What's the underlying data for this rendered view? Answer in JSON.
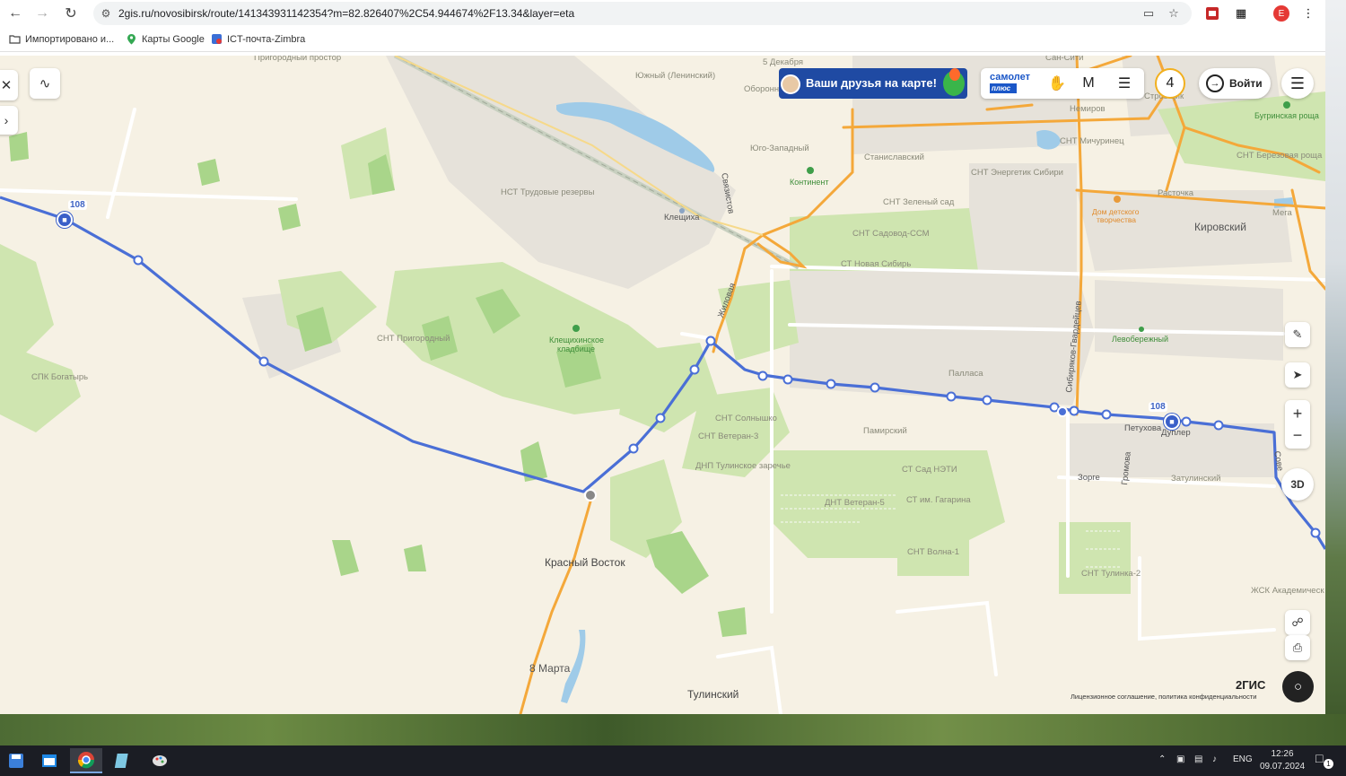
{
  "browser": {
    "url": "2gis.ru/novosibirsk/route/141343931142354?m=82.826407%2C54.944674%2F13.34&layer=eta",
    "profile_initial": "E",
    "bookmarks": [
      {
        "label": "Импортировано и...",
        "icon": "folder-icon"
      },
      {
        "label": "Карты Google",
        "icon": "google-maps-icon"
      },
      {
        "label": "ICT-почта-Zimbra",
        "icon": "zimbra-icon"
      }
    ]
  },
  "map": {
    "route_number": "108",
    "labels": {
      "prigorodny_prostor": "Пригородный простор",
      "dekabrya": "5 Декабря",
      "yuzhny": "Южный (Ленинский)",
      "oboron": "Оборонн",
      "yugo_zapadny": "Юго-Западный",
      "kontinent": "Континент",
      "stanislavsky": "Станиславский",
      "snt_energetik": "СНТ Энергетик Сибири",
      "snt_michurinets": "СНТ Мичуринец",
      "snt_berezovaya": "СНТ Березовая роща",
      "bugrinskaya": "Бугринская роща",
      "raschotka": "Расточка",
      "dom_tvorchestva_1": "Дом детского",
      "dom_tvorchestva_2": "творчества",
      "mega": "Мега",
      "kirovsky": "Кировский",
      "nst_trudovye": "НСТ Трудовые резервы",
      "kleshchikha": "Клещиха",
      "svyazistov": "Связистов",
      "snt_zeleny_sad": "СНТ Зеленый сад",
      "snt_sadovod": "СНТ Садовод-ССМ",
      "st_novaya_sibir": "СТ Новая Сибирь",
      "zhilovaya": "Жиловая",
      "snt_prigorodny": "СНТ Пригородный",
      "kladbishche_1": "Клещихинское",
      "kladbishche_2": "кладбище",
      "spk_bogatyr": "СПК Богатырь",
      "pallasa": "Палласа",
      "sibiryakov": "Сибиряков-Гвардейцев",
      "levoberezhny": "Левобережный",
      "snt_solnyshko": "СНТ Солнышко",
      "snt_veteran3": "СНТ Ветеран-3",
      "dnp_tulinskoe": "ДНП Тулинское заречье",
      "pamirsky": "Памирский",
      "st_sad_neti": "СТ Сад НЭТИ",
      "st_gagarina": "СТ им. Гагарина",
      "dnt_veteran5": "ДНТ Ветеран-5",
      "zorge": "Зорге",
      "gromova": "Громова",
      "zatulinsky": "Затулинский",
      "petukhova": "Петухова",
      "dupler": "Дуплер",
      "krasny_vostok": "Красный Восток",
      "snt_volna": "СНТ Волна-1",
      "snt_tulinka": "СНТ Тулинка-2",
      "zhsk": "ЖСК Академическ",
      "marta": "8 Марта",
      "tulinsky": "Тулинский",
      "nemirov": "Немиров",
      "stroviki": "Стровщик",
      "kan_siti": "Сан-Сити",
      "sov": "Сове"
    },
    "promo_text": "Ваши друзья на карте!",
    "samolet": "самолет",
    "samolet_sub": "плюс",
    "friends_count": "4",
    "login_label": "Войти",
    "btn_3d": "3D",
    "zoom_in": "+",
    "zoom_out": "−",
    "logo": "2ГИС",
    "license": "Лицензионное соглашение, политика конфиденциальности"
  },
  "taskbar": {
    "lang": "ENG",
    "time": "12:26",
    "date": "09.07.2024",
    "notifications": "1"
  }
}
